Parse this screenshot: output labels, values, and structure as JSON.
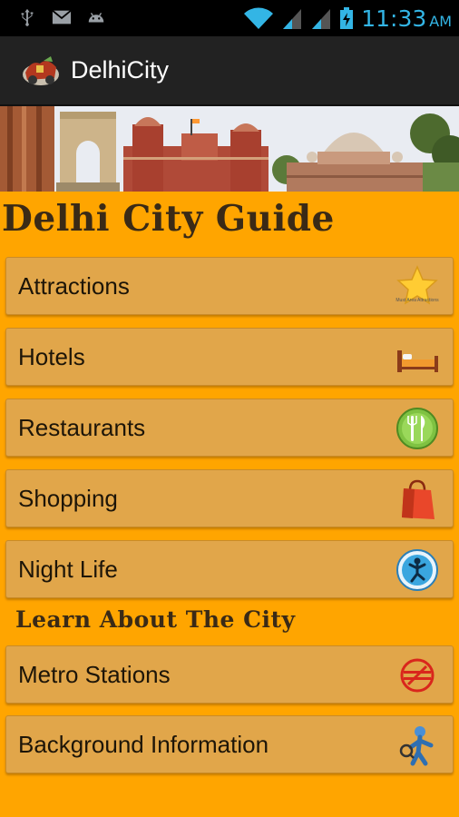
{
  "status_bar": {
    "time": "11:33",
    "ampm": "AM",
    "icons": [
      "usb-icon",
      "gmail-icon",
      "android-debug-icon",
      "wifi-icon",
      "signal-icon",
      "signal-icon",
      "battery-charging-icon"
    ]
  },
  "action_bar": {
    "title": "DelhiCity",
    "icon": "app-logo-icon"
  },
  "banner": {
    "description_icon": "delhi-monuments-banner"
  },
  "main_title": "Delhi City Guide",
  "menu": [
    {
      "label": "Attractions",
      "icon": "star-attractions-icon",
      "icon_caption": "Must Area Attractions"
    },
    {
      "label": "Hotels",
      "icon": "bed-icon"
    },
    {
      "label": "Restaurants",
      "icon": "fork-knife-icon"
    },
    {
      "label": "Shopping",
      "icon": "shopping-bag-icon"
    },
    {
      "label": "Night Life",
      "icon": "dancer-icon"
    }
  ],
  "section_title": "Learn About The City",
  "learn_menu": [
    {
      "label": "Metro Stations",
      "icon": "metro-logo-icon"
    },
    {
      "label": "Background Information",
      "icon": "info-person-icon"
    }
  ],
  "colors": {
    "background": "#ffa500",
    "row_bg": "#e1a64a",
    "action_bar": "#222222",
    "status_accent": "#33b5e5",
    "heading": "#3a2a16"
  }
}
